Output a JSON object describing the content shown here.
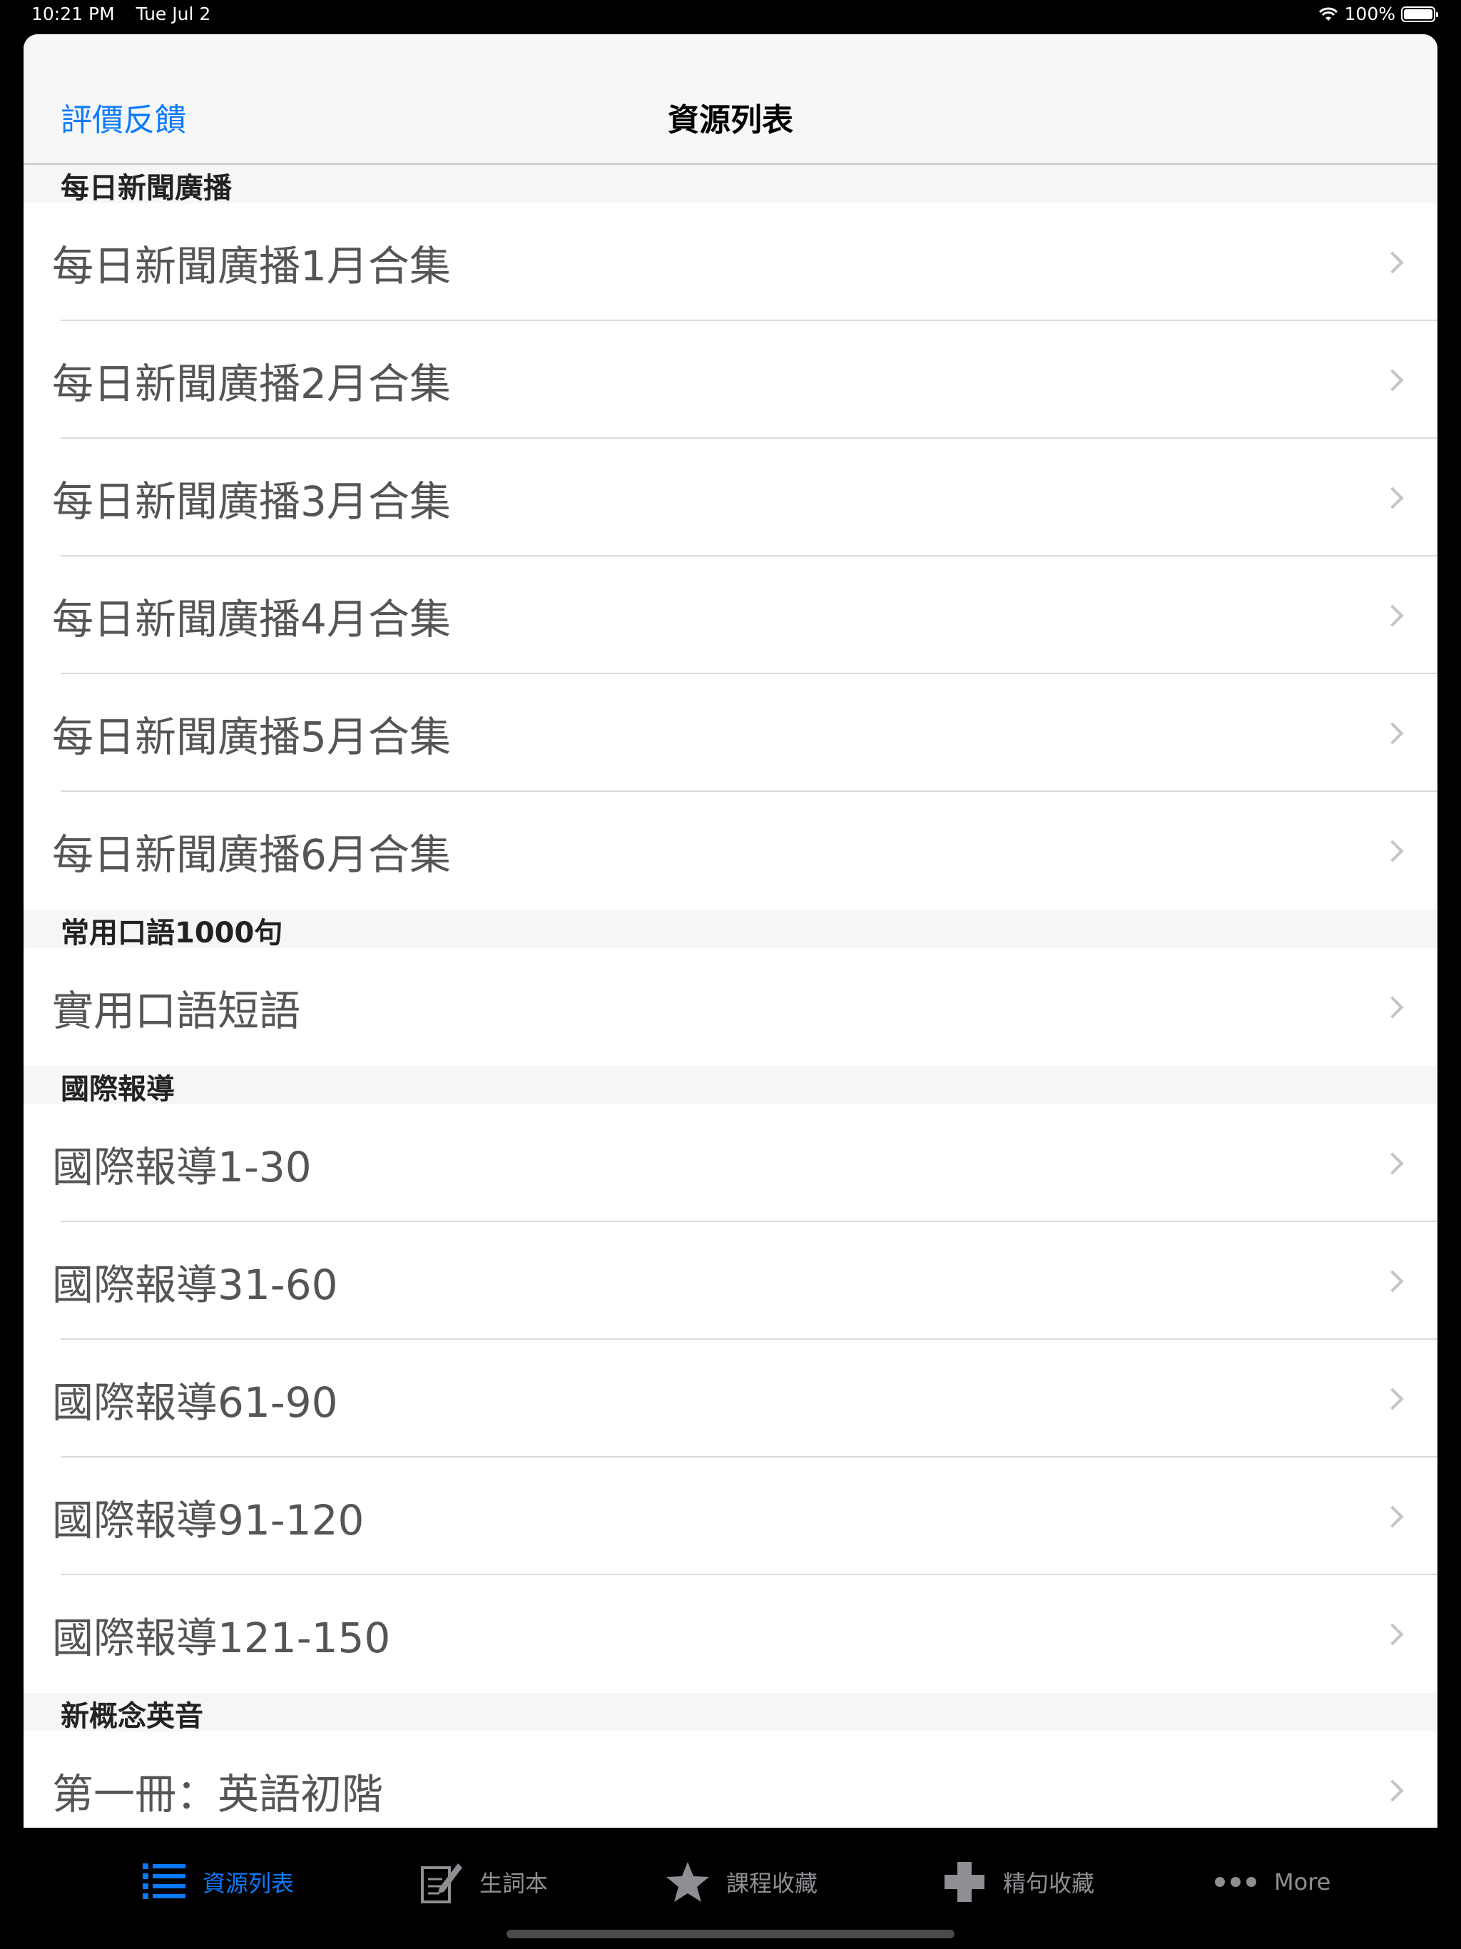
{
  "status_bar": {
    "time": "10:21 PM",
    "date": "Tue Jul 2",
    "battery_text": "100%",
    "battery_level": 1.0
  },
  "nav": {
    "left_label": "評價反饋",
    "title": "資源列表"
  },
  "sections": [
    {
      "header": "每日新聞廣播",
      "rows": [
        "每日新聞廣播1月合集",
        "每日新聞廣播2月合集",
        "每日新聞廣播3月合集",
        "每日新聞廣播4月合集",
        "每日新聞廣播5月合集",
        "每日新聞廣播6月合集"
      ]
    },
    {
      "header": "常用口語1000句",
      "rows": [
        "實用口語短語"
      ]
    },
    {
      "header": "國際報導",
      "rows": [
        "國際報導1-30",
        "國際報導31-60",
        "國際報導61-90",
        "國際報導91-120",
        "國際報導121-150"
      ]
    },
    {
      "header": "新概念英音",
      "rows": [
        "第一冊：英語初階"
      ]
    }
  ],
  "tabs": [
    {
      "label": "資源列表",
      "icon": "list-icon",
      "active": true
    },
    {
      "label": "生詞本",
      "icon": "notebook-pen-icon",
      "active": false
    },
    {
      "label": "課程收藏",
      "icon": "star-icon",
      "active": false
    },
    {
      "label": "精句收藏",
      "icon": "plus-icon",
      "active": false
    },
    {
      "label": "More",
      "icon": "more-dots-icon",
      "active": false
    }
  ],
  "colors": {
    "accent": "#0a7aff",
    "inactive_tab": "#8e8e93"
  }
}
